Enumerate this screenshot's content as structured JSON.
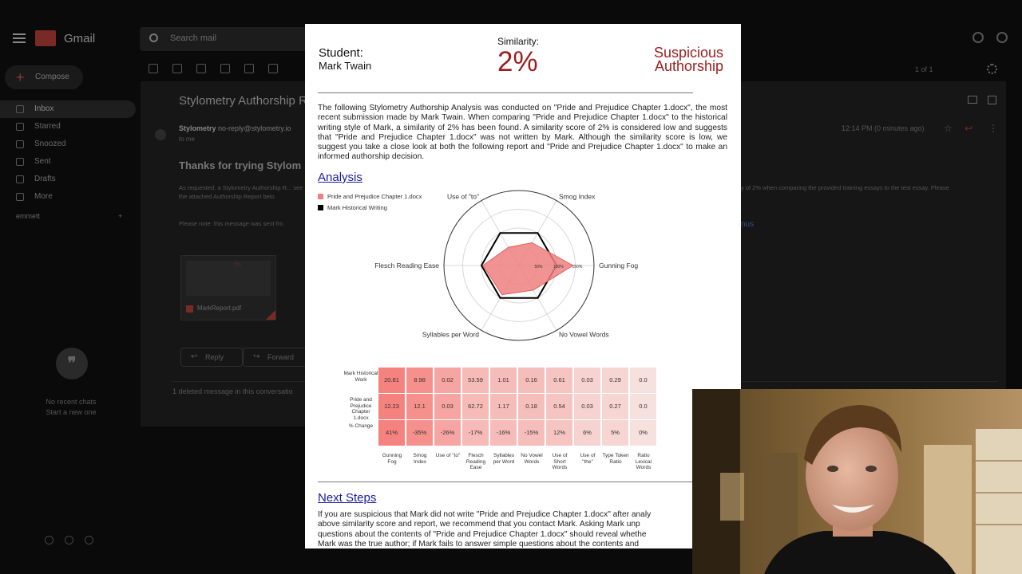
{
  "gmail": {
    "app_name": "Gmail",
    "search_placeholder": "Search mail",
    "compose_label": "Compose",
    "nav": [
      {
        "label": "Inbox",
        "active": true
      },
      {
        "label": "Starred",
        "active": false
      },
      {
        "label": "Snoozed",
        "active": false
      },
      {
        "label": "Sent",
        "active": false
      },
      {
        "label": "Drafts",
        "active": false
      },
      {
        "label": "More",
        "active": false
      }
    ],
    "user_name": "emmett",
    "no_chats": "No recent chats",
    "start_chat": "Start a new one",
    "paging": "1 of 1",
    "subject": "Stylometry Authorship R",
    "sender_name": "Stylometry",
    "sender_email": "no-reply@stylometry.io",
    "to": "to me",
    "time": "12:14 PM (0 minutes ago)",
    "heading": "Thanks for trying Stylom",
    "body_left": "As requested, a Stylometry Authorship R... see the attached Authorship Report belo",
    "body_right": "y of 2% when comparing the provided training essays to the test essay. Please",
    "note": "Please note: this message was sent fro",
    "link_fragment": "nus",
    "attachment_name": "MarkReport.pdf",
    "reply_label": "Reply",
    "forward_label": "Forward",
    "deleted_note": "1 deleted message in this conversatio"
  },
  "report": {
    "student_label": "Student:",
    "student_name": "Mark Twain",
    "similarity_label": "Similarity:",
    "similarity_value": "2%",
    "verdict_line1": "Suspicious",
    "verdict_line2": "Authorship",
    "intro": "The following Stylometry Authorship Analysis was conducted on \"Pride and Prejudice Chapter 1.docx\", the most recent submission made by Mark Twain. When comparing \"Pride and Prejudice Chapter 1.docx\" to the historical writing style of Mark, a similarity of 2% has been found. A similarity score of 2% is considered low and suggests that \"Pride and Prejudice Chapter 1.docx\" was not written by Mark. Although the similarity score is low, we suggest you take a close look at both the following report and \"Pride and Prejudice Chapter 1.docx\" to make an informed authorship decision.",
    "analysis_heading": "Analysis",
    "next_steps_heading": "Next Steps",
    "next_steps_line1": "If you are suspicious that Mark did not write \"Pride and Prejudice Chapter 1.docx\" after analy",
    "next_steps_line2": "above similarity score and report, we recommend that you contact Mark. Asking Mark unp",
    "next_steps_line3": "questions about the contents of \"Pride and Prejudice Chapter 1.docx\" should reveal whethe",
    "next_steps_line4": "Mark was the true author; if Mark fails to answer simple questions about the contents and"
  },
  "chart_data": [
    {
      "type": "radar",
      "axes": [
        "Gunning Fog",
        "Smog Index",
        "Use of \"to\"",
        "Flesch Reading Ease",
        "Syllables per Word",
        "No Vowel Words"
      ],
      "series": [
        {
          "name": "Pride and Prejudice Chapter 1.docx",
          "color": "#f08080",
          "values": [
            0.72,
            0.35,
            0.28,
            0.48,
            0.45,
            0.38
          ]
        },
        {
          "name": "Mark Historical Writing",
          "color": "#000000",
          "values": [
            0.5,
            0.5,
            0.5,
            0.5,
            0.5,
            0.5
          ]
        }
      ],
      "radial_tick_labels": [
        "50%",
        "100%",
        "150%"
      ],
      "grid": true,
      "legend_position": "top-left"
    },
    {
      "type": "heatmap",
      "row_labels": [
        "Mark Historical Work",
        "Pride and Prejudice Chapter 1.docx",
        "% Change"
      ],
      "col_labels": [
        "Gunning Fog",
        "Smog Index",
        "Use of \"to\"",
        "Flesch Reading Ease",
        "Syllables per Word",
        "No Vowel Words",
        "Use of Short Words",
        "Use of \"the\"",
        "Type Token Ratio",
        "Ratio Lexical Words"
      ],
      "cells": [
        [
          "20.81",
          "8.98",
          "0.02",
          "53.59",
          "1.01",
          "0.16",
          "0.61",
          "0.03",
          "0.29",
          "0.0"
        ],
        [
          "12.23",
          "12.1",
          "0.03",
          "62.72",
          "1.17",
          "0.18",
          "0.54",
          "0.03",
          "0.27",
          "0.0"
        ],
        [
          "41%",
          "-35%",
          "-26%",
          "-17%",
          "-16%",
          "-15%",
          "12%",
          "6%",
          "5%",
          "0%"
        ]
      ],
      "change_magnitude": [
        41,
        35,
        26,
        17,
        16,
        15,
        12,
        6,
        5,
        0
      ]
    }
  ],
  "colors": {
    "verdict": "#9e1c1c",
    "heading_link": "#1a1aa0",
    "series_pride": "#f08080",
    "series_mark": "#000000"
  }
}
